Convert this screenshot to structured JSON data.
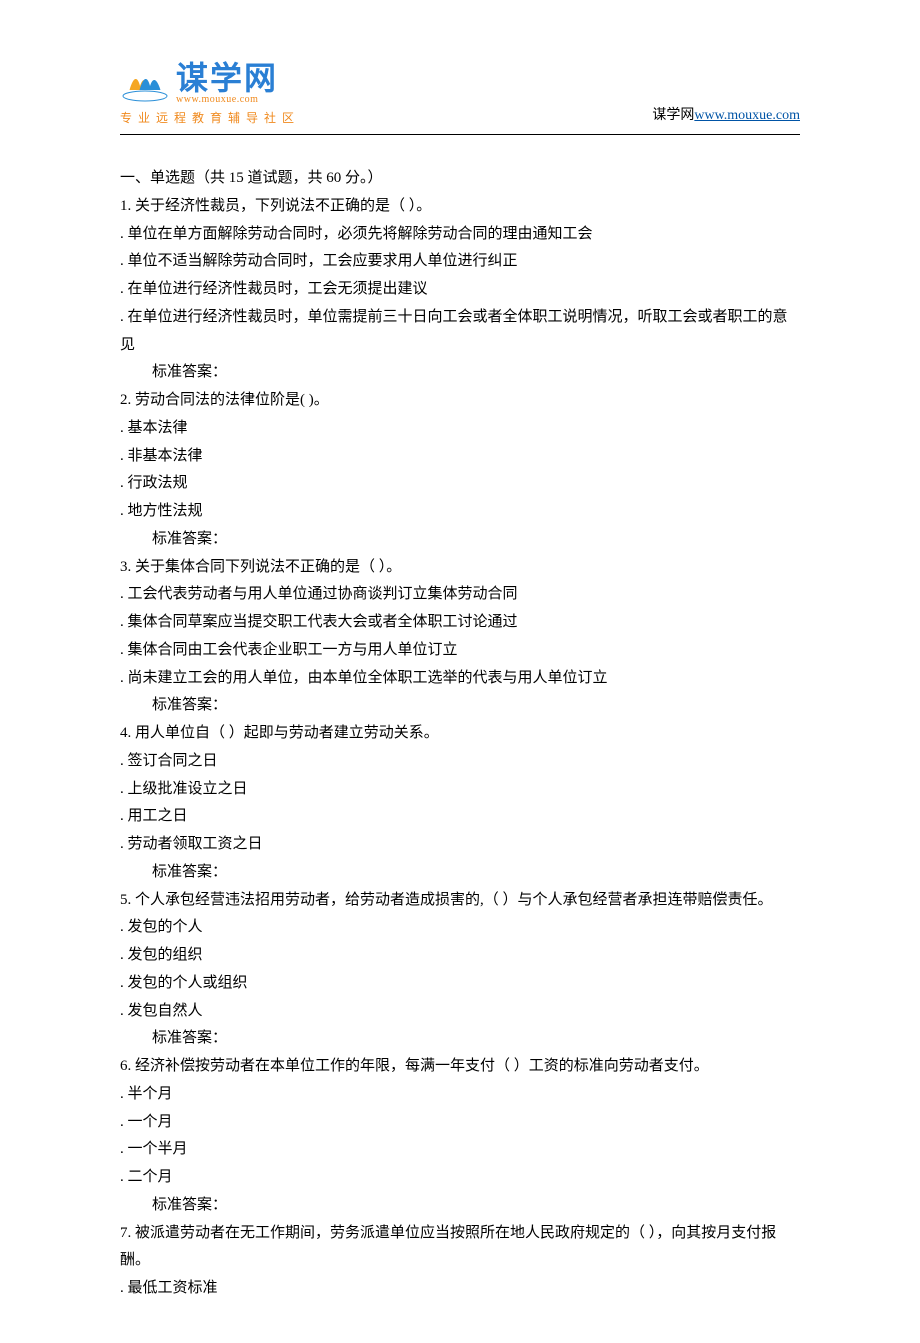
{
  "header": {
    "logo_cn": "谋学网",
    "logo_url": "www.mouxue.com",
    "logo_sub": "专业远程教育辅导社区",
    "site_label": "谋学网",
    "site_link": "www.mouxue.com"
  },
  "section_title": "一、单选题（共 15 道试题，共 60 分。）",
  "answer_label": "标准答案：",
  "questions": [
    {
      "stem": "1.  关于经济性裁员，下列说法不正确的是（ ）。",
      "options": [
        ". 单位在单方面解除劳动合同时，必须先将解除劳动合同的理由通知工会",
        ". 单位不适当解除劳动合同时，工会应要求用人单位进行纠正",
        ". 在单位进行经济性裁员时，工会无须提出建议",
        ". 在单位进行经济性裁员时，单位需提前三十日向工会或者全体职工说明情况，听取工会或者职工的意见"
      ]
    },
    {
      "stem": "2.  劳动合同法的法律位阶是( )。",
      "options": [
        ". 基本法律",
        ". 非基本法律",
        ". 行政法规",
        ". 地方性法规"
      ]
    },
    {
      "stem": "3.  关于集体合同下列说法不正确的是（ ）。",
      "options": [
        ". 工会代表劳动者与用人单位通过协商谈判订立集体劳动合同",
        ". 集体合同草案应当提交职工代表大会或者全体职工讨论通过",
        ". 集体合同由工会代表企业职工一方与用人单位订立",
        ". 尚未建立工会的用人单位，由本单位全体职工选举的代表与用人单位订立"
      ]
    },
    {
      "stem": "4.  用人单位自（ ）起即与劳动者建立劳动关系。",
      "options": [
        ". 签订合同之日",
        ". 上级批准设立之日",
        ". 用工之日",
        ". 劳动者领取工资之日"
      ]
    },
    {
      "stem": "5.  个人承包经营违法招用劳动者，给劳动者造成损害的,（ ）与个人承包经营者承担连带赔偿责任。",
      "options": [
        ". 发包的个人",
        ". 发包的组织",
        ". 发包的个人或组织",
        ". 发包自然人"
      ]
    },
    {
      "stem": "6.  经济补偿按劳动者在本单位工作的年限，每满一年支付（ ）工资的标准向劳动者支付。",
      "options": [
        ". 半个月",
        ". 一个月",
        ". 一个半月",
        ". 二个月"
      ]
    },
    {
      "stem": "7.  被派遣劳动者在无工作期间，劳务派遣单位应当按照所在地人民政府规定的（ ），向其按月支付报酬。",
      "options": [
        ". 最低工资标准"
      ],
      "partial": true
    }
  ]
}
